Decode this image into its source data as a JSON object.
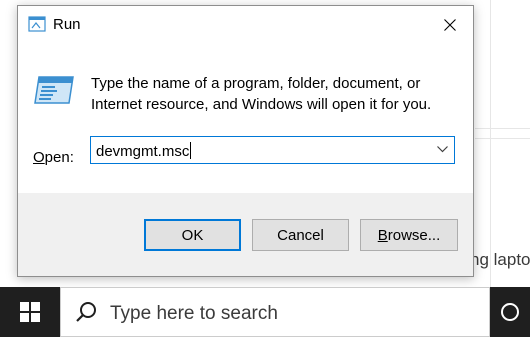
{
  "dialog": {
    "title": "Run",
    "description": "Type the name of a program, folder, document, or Internet resource, and Windows will open it for you.",
    "open_label_accel": "O",
    "open_label_rest": "pen:",
    "input_value": "devmgmt.msc",
    "buttons": {
      "ok": "OK",
      "cancel": "Cancel",
      "browse_accel": "B",
      "browse_rest": "rowse..."
    }
  },
  "background": {
    "snippet": "ng lapto"
  },
  "taskbar": {
    "search_placeholder": "Type here to search"
  },
  "colors": {
    "accent": "#0078d7",
    "taskbar": "#1f1f1f",
    "button_face": "#e1e1e1",
    "dialog_face": "#f0f0f0"
  },
  "icons": [
    "run-icon",
    "close-icon",
    "chevron-down-icon",
    "windows-logo-icon",
    "search-icon",
    "cortana-icon"
  ]
}
